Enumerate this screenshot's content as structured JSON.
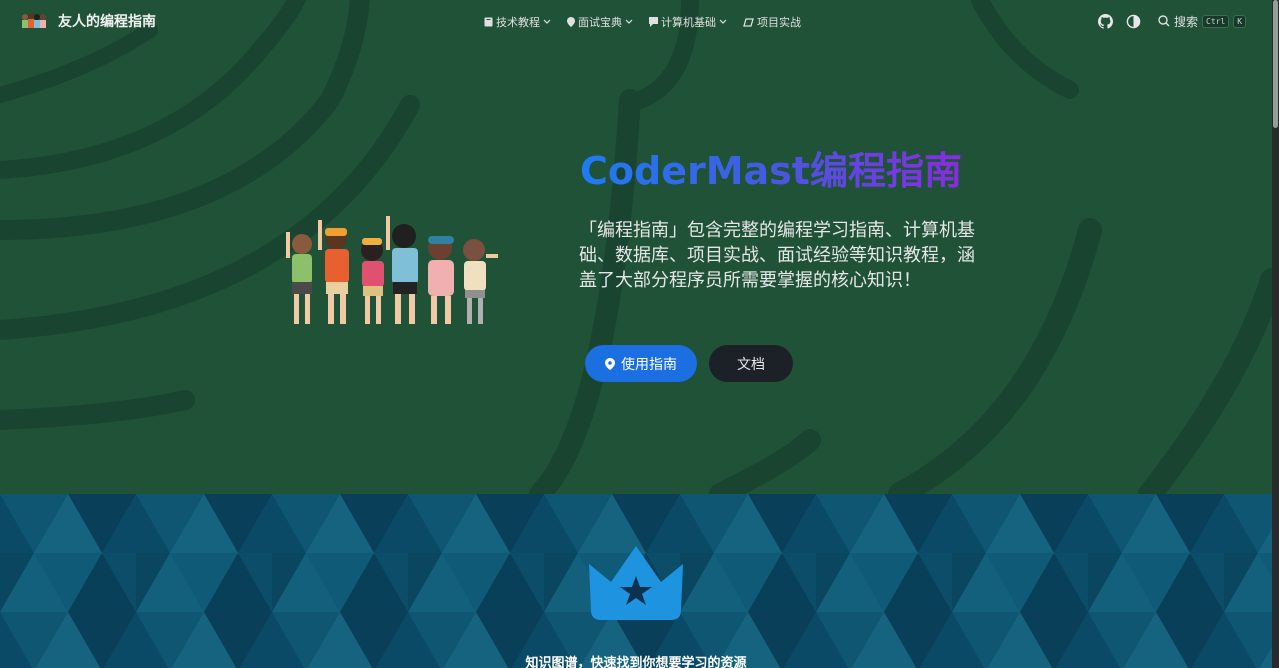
{
  "brand": {
    "title": "友人的编程指南",
    "logo_icon": "kids-group-logo"
  },
  "nav": {
    "items": [
      {
        "label": "技术教程",
        "icon": "book-icon",
        "has_dropdown": true
      },
      {
        "label": "面试宝典",
        "icon": "pin-icon",
        "has_dropdown": true
      },
      {
        "label": "计算机基础",
        "icon": "chat-icon",
        "has_dropdown": true
      },
      {
        "label": "项目实战",
        "icon": "eraser-icon",
        "has_dropdown": false
      }
    ],
    "github_icon": "github-icon",
    "theme_icon": "theme-toggle-icon",
    "search_label": "搜索",
    "search_keys": [
      "Ctrl",
      "K"
    ]
  },
  "hero": {
    "title": "CoderMast编程指南",
    "description": "「编程指南」包含完整的编程学习指南、计算机基础、数据库、项目实战、面试经验等知识教程，涵盖了大部分程序员所需要掌握的核心知识！",
    "primary_button": "使用指南",
    "secondary_button": "文档",
    "illustration": "kids-cheering-illustration"
  },
  "features": {
    "icon": "crown-star-icon",
    "caption": "知识图谱，快速找到你想要学习的资源"
  },
  "colors": {
    "hero_bg": "#1f5237",
    "hero_stripe": "#194530",
    "primary": "#1b6fe0",
    "secondary_bg": "#1c2128",
    "features_bg": "#0b4a66",
    "crown": "#1e94e0"
  }
}
